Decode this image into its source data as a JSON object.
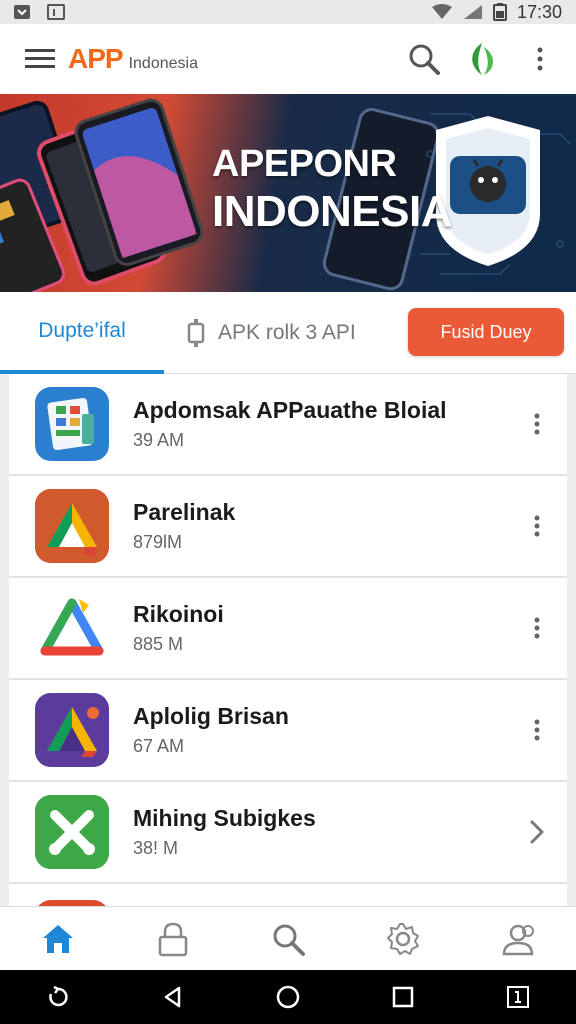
{
  "status_bar": {
    "time": "17:30"
  },
  "app_bar": {
    "logo_text": "APP",
    "logo_subtitle": "Indonesia"
  },
  "banner": {
    "title_line1": "APEPONR",
    "title_line2": "INDONESIA"
  },
  "tabs": {
    "active_label": "Dupte’ifal",
    "second_label": "APK rolk  3 API",
    "cta_label": "Fusid Duey"
  },
  "apps": [
    {
      "name": "Apdomsak APPauathe Bloial",
      "sub": "39 AM",
      "action_icon": "more-vert-icon"
    },
    {
      "name": "Parelinak",
      "sub": "879lM",
      "action_icon": "more-vert-icon"
    },
    {
      "name": "Rikoinoi",
      "sub": "885 M",
      "action_icon": "more-vert-icon"
    },
    {
      "name": "Aplolig Brisan",
      "sub": "67 AM",
      "action_icon": "more-vert-icon"
    },
    {
      "name": "Mihing Subigkes",
      "sub": "38! M",
      "action_icon": "chevron-right-icon"
    }
  ],
  "colors": {
    "accent": "#1e88d6",
    "cta": "#ea5a36",
    "logo": "#f06a1a"
  }
}
